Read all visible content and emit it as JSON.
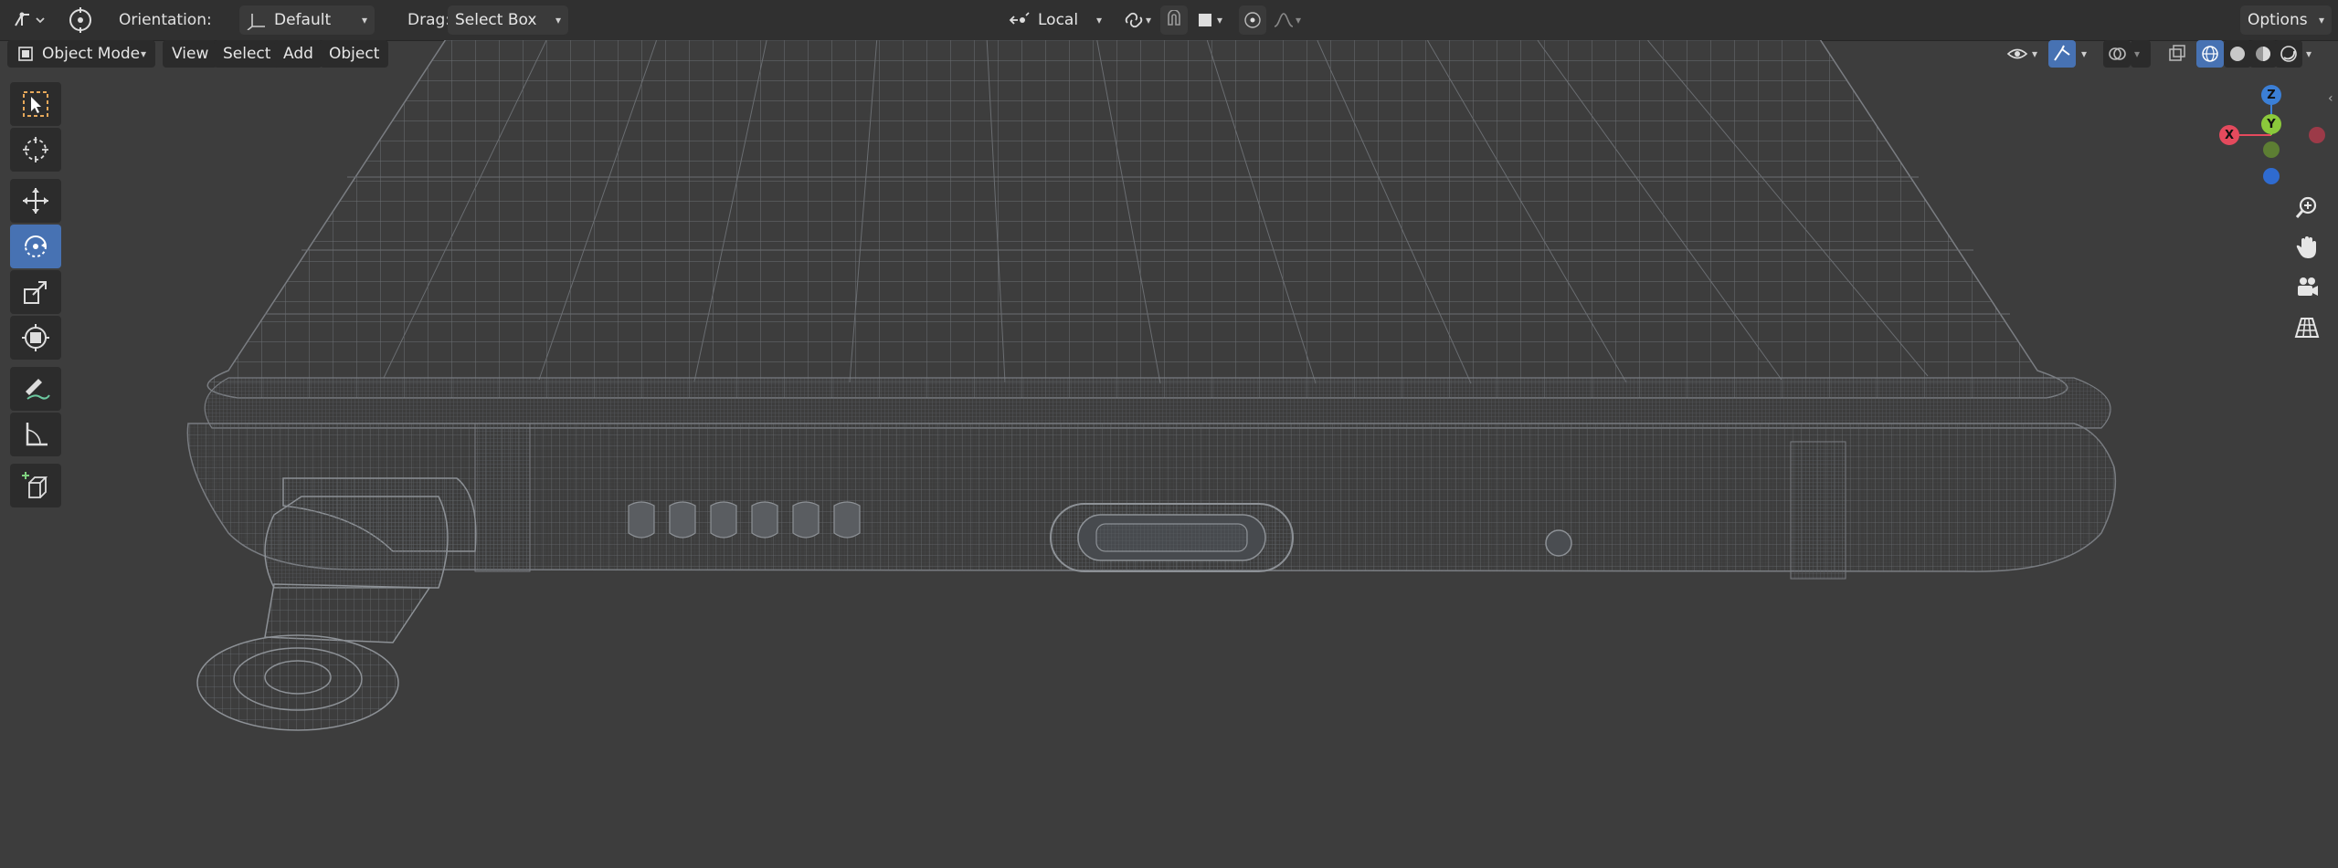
{
  "header": {
    "orientation_label": "Orientation:",
    "orientation_value": "Default",
    "drag_label": "Drag:",
    "drag_value": "Select Box",
    "pivot_value": "Local",
    "options_label": "Options"
  },
  "menu": {
    "mode": "Object Mode",
    "view": "View",
    "select": "Select",
    "add": "Add",
    "object": "Object"
  },
  "gizmo": {
    "x_label": "X",
    "y_label": "Y",
    "z_label": "Z",
    "x_color": "#e44a5d",
    "y_color": "#8bc93b",
    "z_color": "#3b7fd6"
  },
  "colors": {
    "accent": "#4772b3",
    "viewport_bg": "#3d3d3d",
    "wire": "#8a8e93"
  },
  "tools": [
    {
      "name": "select-box-tool",
      "icon": "select-box-icon",
      "active": false
    },
    {
      "name": "cursor-tool",
      "icon": "cursor-icon",
      "active": false
    },
    {
      "name": "move-tool",
      "icon": "move-icon",
      "active": false
    },
    {
      "name": "rotate-tool",
      "icon": "rotate-icon",
      "active": true
    },
    {
      "name": "scale-tool",
      "icon": "scale-icon",
      "active": false
    },
    {
      "name": "transform-tool",
      "icon": "transform-icon",
      "active": false
    },
    {
      "name": "annotate-tool",
      "icon": "annotate-icon",
      "active": false
    },
    {
      "name": "measure-tool",
      "icon": "measure-icon",
      "active": false
    },
    {
      "name": "add-cube-tool",
      "icon": "add-cube-icon",
      "active": false
    }
  ]
}
